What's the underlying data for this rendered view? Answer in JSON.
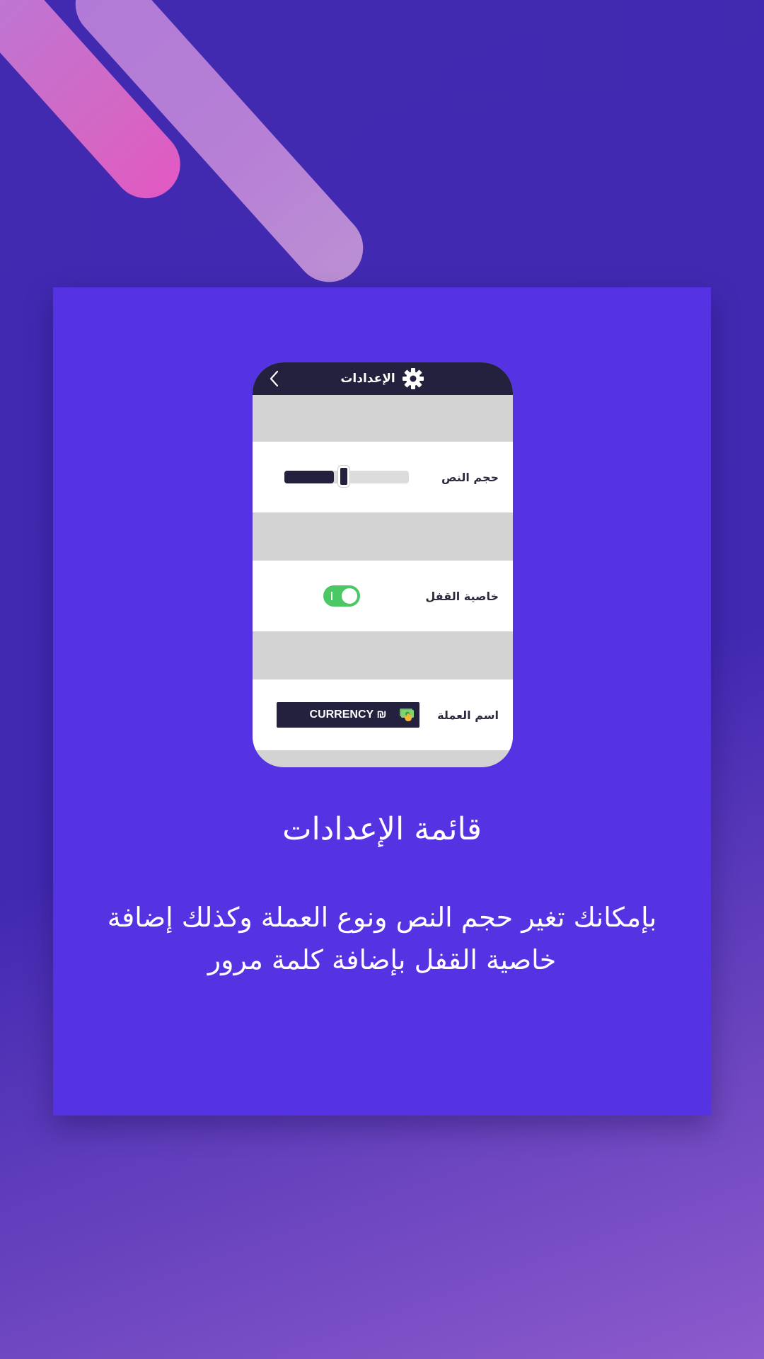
{
  "settings_screen": {
    "header_title": "الإعدادات",
    "rows": [
      {
        "label": "حجم النص",
        "control": "slider",
        "value_fraction": 0.5
      },
      {
        "label": "خاصية القفل",
        "control": "toggle",
        "on": true
      },
      {
        "label": "اسم العملة",
        "control": "currency",
        "currency_text": "CURRENCY ₪"
      }
    ]
  },
  "promo": {
    "title": "قائمة الإعدادات",
    "description": "بإمكانك تغير حجم النص ونوع العملة وكذلك إضافة خاصية القفل بإضافة كلمة مرور"
  },
  "colors": {
    "background": "#4229b2",
    "card": "#5533e3",
    "phone_dark": "#23213d",
    "toggle_on": "#4cc766"
  },
  "icons": [
    "back-chevron-icon",
    "gear-icon",
    "money-icon"
  ]
}
